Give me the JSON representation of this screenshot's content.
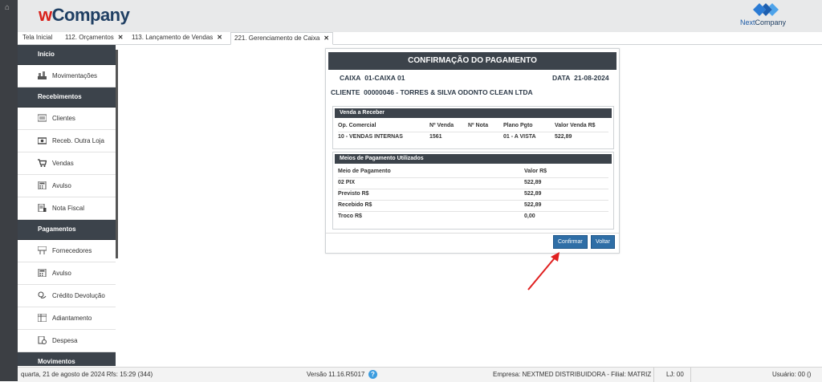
{
  "header": {
    "logo_prefix": "w",
    "logo_rest": "Company",
    "partner_prefix": "Next",
    "partner_rest": "Company"
  },
  "tabs": [
    {
      "label": "Tela Inicial",
      "closable": false
    },
    {
      "label": "112. Orçamentos",
      "closable": true
    },
    {
      "label": "113. Lançamento de Vendas",
      "closable": true
    },
    {
      "label": "221. Gerenciamento de Caixa",
      "closable": true,
      "active": true
    }
  ],
  "sidebar": {
    "sections": [
      {
        "title": "Início",
        "items": [
          {
            "label": "Movimentações",
            "icon": "movements-icon"
          }
        ]
      },
      {
        "title": "Recebimentos",
        "items": [
          {
            "label": "Clientes",
            "icon": "clients-icon"
          },
          {
            "label": "Receb. Outra Loja",
            "icon": "other-store-icon"
          },
          {
            "label": "Vendas",
            "icon": "cart-icon"
          },
          {
            "label": "Avulso",
            "icon": "calculator-icon"
          },
          {
            "label": "Nota Fiscal",
            "icon": "invoice-icon"
          }
        ]
      },
      {
        "title": "Pagamentos",
        "items": [
          {
            "label": "Fornecedores",
            "icon": "suppliers-icon"
          },
          {
            "label": "Avulso",
            "icon": "calculator-icon"
          },
          {
            "label": "Crédito Devolução",
            "icon": "refund-icon"
          },
          {
            "label": "Adiantamento",
            "icon": "advance-icon"
          },
          {
            "label": "Despesa",
            "icon": "expense-icon"
          }
        ]
      },
      {
        "title": "Movimentos",
        "items": []
      }
    ]
  },
  "dialog": {
    "title": "CONFIRMAÇÃO DO PAGAMENTO",
    "caixa_label": "CAIXA",
    "caixa_value": "01-CAIXA 01",
    "data_label": "DATA",
    "data_value": "21-08-2024",
    "cliente_label": "CLIENTE",
    "cliente_value": "00000046 - TORRES & SILVA ODONTO CLEAN LTDA",
    "venda": {
      "heading": "Venda a Receber",
      "headers": [
        "Op. Comercial",
        "Nº Venda",
        "Nº Nota",
        "Plano Pgto",
        "Valor Venda R$"
      ],
      "row": [
        "10 - VENDAS INTERNAS",
        "1561",
        "",
        "01 - A VISTA",
        "522,89"
      ]
    },
    "meios": {
      "heading": "Meios de Pagamento Utilizados",
      "headers": [
        "Meio de Pagamento",
        "Valor R$"
      ],
      "rows": [
        {
          "label": "02 PIX",
          "value": "522,89",
          "bold": false
        },
        {
          "label": "Previsto R$",
          "value": "522,89",
          "bold": true
        },
        {
          "label": "Recebido R$",
          "value": "522,89",
          "bold": true
        },
        {
          "label": "Troco R$",
          "value": "0,00",
          "bold": true
        }
      ]
    },
    "confirm_label": "Confirmar",
    "back_label": "Voltar"
  },
  "status": {
    "datetime": "quarta, 21 de agosto de 2024  Rfs: 15:29 (344)",
    "version": "Versão 11.16.R5017",
    "help": "?",
    "empresa": "Empresa: NEXTMED DISTRIBUIDORA - Filial: MATRIZ",
    "lj": "LJ: 00",
    "usuario": "Usuário: 00 ()"
  },
  "colors": {
    "brand_red": "#d9221c",
    "brand_navy": "#1f3f63",
    "dark_panel": "#3c434b",
    "button_blue": "#2f6ea6",
    "annotation_arrow": "#e02020"
  }
}
